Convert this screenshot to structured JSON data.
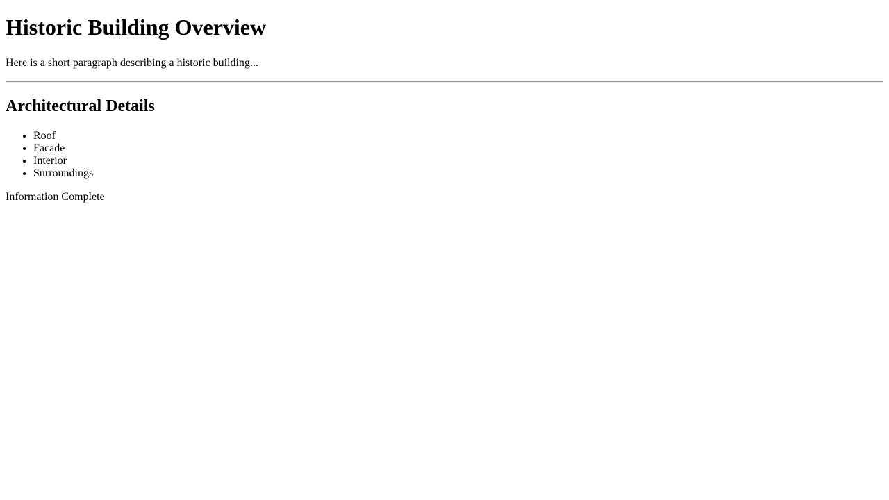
{
  "page": {
    "title": "Historic Building Overview",
    "intro": "Here is a short paragraph describing a historic building...",
    "section_heading": "Architectural Details",
    "details": [
      "Roof",
      "Facade",
      "Interior",
      "Surroundings"
    ],
    "status": "Information Complete"
  }
}
